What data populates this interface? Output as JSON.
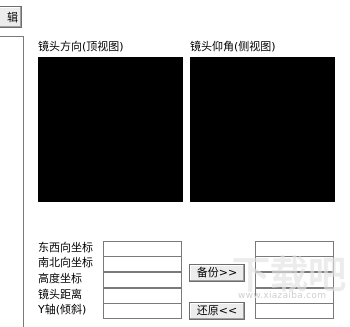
{
  "toolbar": {
    "edit_label": "辑"
  },
  "views": {
    "top_title": "镜头方向(顶视图)",
    "side_title": "镜头仰角(侧视图)"
  },
  "fields": {
    "east_west": {
      "label": "东西向坐标",
      "value": ""
    },
    "north_south": {
      "label": "南北向坐标",
      "value": ""
    },
    "height": {
      "label": "高度坐标",
      "value": ""
    },
    "distance": {
      "label": "镜头距离",
      "value": ""
    },
    "y_axis": {
      "label": "Y轴(倾斜)",
      "value": ""
    }
  },
  "buttons": {
    "backup": "备份>>",
    "restore": "还原<<"
  },
  "watermark": {
    "brand": "下载吧",
    "url": "www.xiazaiba.com"
  }
}
